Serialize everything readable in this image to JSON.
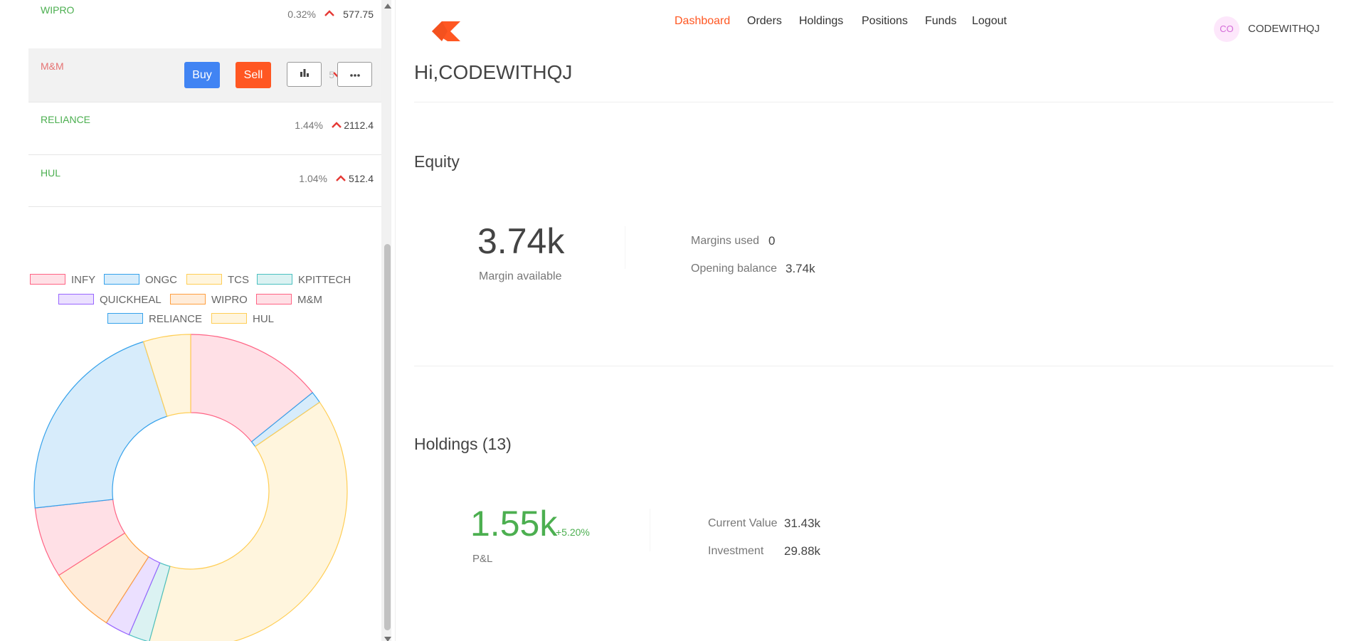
{
  "watchlist": [
    {
      "name": "WIPRO",
      "change_pct": "0.32%",
      "direction": "up",
      "price": "577.75",
      "name_color": "#4caf50"
    },
    {
      "name": "M&M",
      "change_pct": "0.50%",
      "direction": "down",
      "price": "",
      "name_color": "#e57373"
    },
    {
      "name": "RELIANCE",
      "change_pct": "1.44%",
      "direction": "up",
      "price": "2112.4",
      "name_color": "#4caf50"
    },
    {
      "name": "HUL",
      "change_pct": "1.04%",
      "direction": "up",
      "price": "512.4",
      "name_color": "#4caf50"
    }
  ],
  "row_actions": {
    "buy_label": "Buy",
    "sell_label": "Sell",
    "analytics_icon": "bar-chart-icon",
    "more_icon": "more-horizontal-icon"
  },
  "colors": {
    "brand": "#ff5722",
    "buy": "#4184f3",
    "up_arrow": "#e53935",
    "profit": "#4caf50"
  },
  "chart_data": {
    "type": "pie",
    "categories": [
      "INFY",
      "ONGC",
      "TCS",
      "KPITTECH",
      "QUICKHEAL",
      "WIPRO",
      "M&M",
      "RELIANCE",
      "HUL"
    ],
    "values": [
      16.3,
      1.4,
      44.6,
      2.5,
      3.0,
      7.9,
      8.4,
      25.1,
      5.6
    ],
    "donut": true,
    "legend_position": "top",
    "fill_colors": [
      "#ffe0e6",
      "#d7ecfb",
      "#fff5dd",
      "#dbf2f2",
      "#ebe0ff",
      "#ffecd9",
      "#ffe0e6",
      "#d7ecfb",
      "#fff5dd"
    ],
    "border_colors": [
      "#ff6384",
      "#36a2eb",
      "#ffce56",
      "#4bc0c0",
      "#9966ff",
      "#ff9f40",
      "#ff6384",
      "#36a2eb",
      "#ffce56"
    ]
  },
  "nav": {
    "items": [
      "Dashboard",
      "Orders",
      "Holdings",
      "Positions",
      "Funds",
      "Logout"
    ],
    "active": "Dashboard"
  },
  "user": {
    "initials": "CO",
    "username": "CODEWITHQJ"
  },
  "greeting": "Hi,CODEWITHQJ",
  "equity": {
    "title": "Equity",
    "margin_available": "3.74k",
    "margin_available_label": "Margin available",
    "margins_used_label": "Margins used",
    "margins_used": "0",
    "opening_balance_label": "Opening balance",
    "opening_balance": "3.74k"
  },
  "holdings": {
    "title": "Holdings (13)",
    "pnl": "1.55k",
    "pnl_pct": "+5.20%",
    "pnl_label": "P&L",
    "current_value_label": "Current Value",
    "current_value": "31.43k",
    "investment_label": "Investment",
    "investment": "29.88k"
  }
}
